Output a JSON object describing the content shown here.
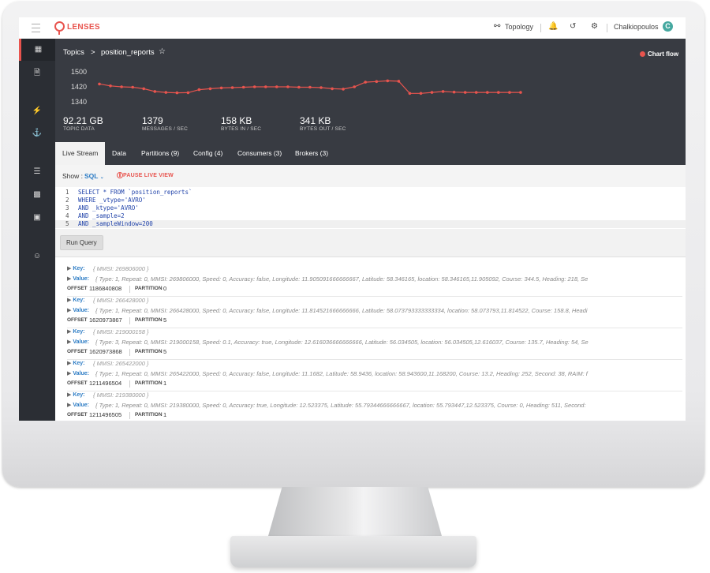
{
  "app": {
    "brand": "LENSES",
    "brand_color": "#e8544e"
  },
  "topbar": {
    "topology_label": "Topology",
    "user_name": "Chalkiopoulos",
    "avatar_letter": "C"
  },
  "breadcrumb": {
    "section": "Topics",
    "separator": ">",
    "topic": "position_reports"
  },
  "chart_flow_label": "Chart flow",
  "sparkline": {
    "type": "line",
    "y_ticks": [
      "1500",
      "1420",
      "1340"
    ],
    "ylim": [
      1340,
      1500
    ],
    "values": [
      1435,
      1425,
      1420,
      1418,
      1410,
      1395,
      1390,
      1388,
      1389,
      1405,
      1410,
      1414,
      1416,
      1418,
      1420,
      1420,
      1420,
      1420,
      1418,
      1418,
      1416,
      1410,
      1408,
      1420,
      1445,
      1448,
      1452,
      1450,
      1385,
      1385,
      1390,
      1395,
      1392,
      1390,
      1390,
      1390,
      1390,
      1390,
      1390
    ],
    "line_color": "#e8544e"
  },
  "stats": [
    {
      "value": "92.21 GB",
      "label": "TOPIC DATA"
    },
    {
      "value": "1379",
      "label": "MESSAGES / SEC"
    },
    {
      "value": "158 KB",
      "label": "BYTES IN / SEC"
    },
    {
      "value": "341 KB",
      "label": "BYTES OUT / SEC"
    }
  ],
  "tabs": [
    "Live Stream",
    "Data",
    "Partitions (9)",
    "Config (4)",
    "Consumers (3)",
    "Brokers (3)"
  ],
  "show": {
    "label": "Show :",
    "mode": "SQL",
    "pause_label": "PAUSE LIVE VIEW"
  },
  "editor": {
    "line_numbers": [
      "1",
      "2",
      "3",
      "4",
      "5"
    ],
    "lines": [
      "SELECT * FROM `position_reports`",
      "WHERE _vtype='AVRO'",
      "AND _ktype='AVRO'",
      "AND _sample=2",
      "AND _sampleWindow=200"
    ]
  },
  "run_button": "Run Query",
  "record_labels": {
    "key": "Key:",
    "value": "Value:",
    "offset": "OFFSET",
    "partition": "PARTITION"
  },
  "records": [
    {
      "key": "{ MMSI: 269806000 }",
      "value": "{ Type: 1, Repeat: 0, MMSI: 269806000, Speed: 0, Accuracy: false, Longitude: 11.905091666666667, Latitude: 58.346165, location: 58.346165,11.905092, Course: 344.5, Heading: 218, Se",
      "offset": "1186840808",
      "partition": "0"
    },
    {
      "key": "{ MMSI: 266428000 }",
      "value": "{ Type: 1, Repeat: 0, MMSI: 266428000, Speed: 0, Accuracy: false, Longitude: 11.814521666666666, Latitude: 58.073793333333334, location: 58.073793,11.814522, Course: 158.8, Headi",
      "offset": "1620973867",
      "partition": "5"
    },
    {
      "key": "{ MMSI: 219000158 }",
      "value": "{ Type: 3, Repeat: 0, MMSI: 219000158, Speed: 0.1, Accuracy: true, Longitude: 12.616036666666666, Latitude: 56.034505, location: 56.034505,12.616037, Course: 135.7, Heading: 54, Se",
      "offset": "1620973868",
      "partition": "5"
    },
    {
      "key": "{ MMSI: 265422000 }",
      "value": "{ Type: 1, Repeat: 0, MMSI: 265422000, Speed: 0, Accuracy: false, Longitude: 11.1682, Latitude: 58.9436, location: 58.943600,11.168200, Course: 13.2, Heading: 252, Second: 38, RAIM: f",
      "offset": "1211496504",
      "partition": "1"
    },
    {
      "key": "{ MMSI: 219380000 }",
      "value": "{ Type: 1, Repeat: 0, MMSI: 219380000, Speed: 0, Accuracy: true, Longitude: 12.523375, Latitude: 55.79344666666667, location: 55.793447,12.523375, Course: 0, Heading: 511, Second:",
      "offset": "1211496505",
      "partition": "1"
    }
  ]
}
